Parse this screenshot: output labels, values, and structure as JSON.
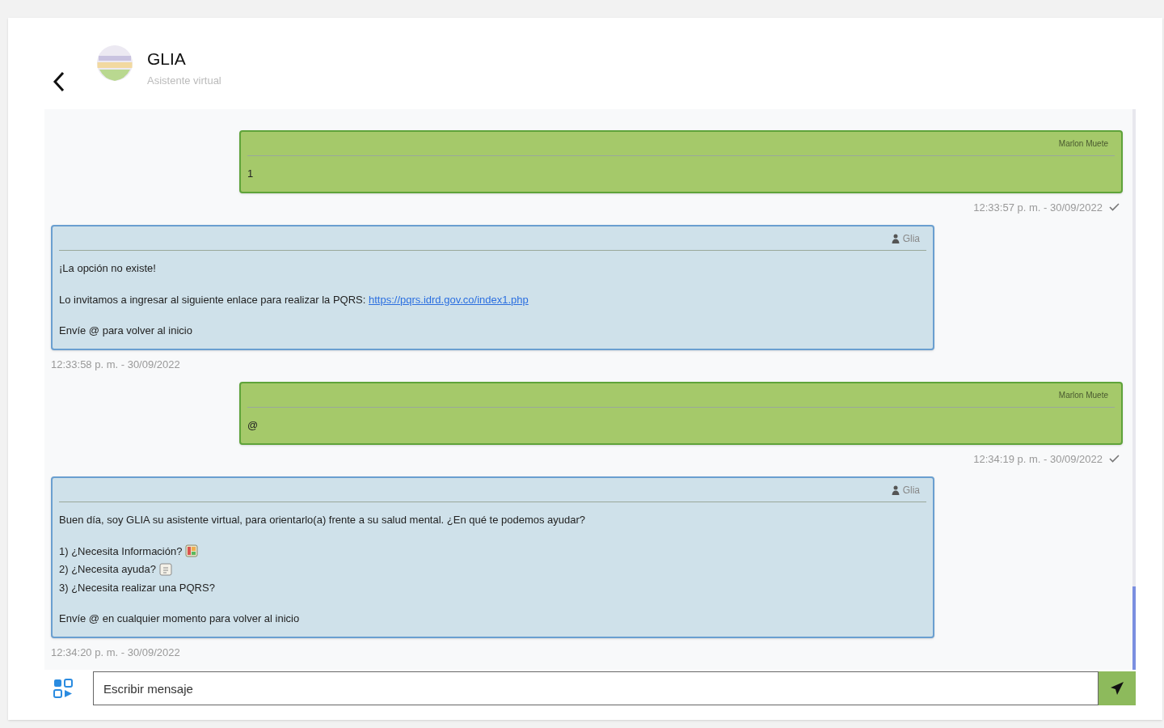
{
  "header": {
    "title": "GLIA",
    "subtitle": "Asistente virtual"
  },
  "messages": [
    {
      "kind": "user",
      "sender": "Marlon Muete",
      "paragraphs": [
        [
          {
            "kind": "plain",
            "text": "1"
          }
        ]
      ],
      "time": "12:33:57 p. m. - 30/09/2022",
      "read": true
    },
    {
      "kind": "bot",
      "sender": "Glia",
      "paragraphs": [
        [
          {
            "kind": "plain",
            "text": "¡La opción no existe!"
          }
        ],
        [
          {
            "kind": "link",
            "text": "Lo invitamos a ingresar al siguiente enlace para realizar la PQRS: ",
            "link": "https://pqrs.idrd.gov.co/index1.php"
          }
        ],
        [
          {
            "kind": "plain",
            "text": "Envíe @ para volver al inicio"
          }
        ]
      ],
      "time": "12:33:58 p. m. - 30/09/2022"
    },
    {
      "kind": "user",
      "sender": "Marlon Muete",
      "paragraphs": [
        [
          {
            "kind": "plain",
            "text": "@"
          }
        ]
      ],
      "time": "12:34:19 p. m. - 30/09/2022",
      "read": true
    },
    {
      "kind": "bot",
      "sender": "Glia",
      "paragraphs": [
        [
          {
            "kind": "plain",
            "text": "Buen día, soy GLIA su asistente virtual, para orientarlo(a) frente a su salud mental. ¿En qué te podemos ayudar?"
          }
        ],
        [
          {
            "kind": "book",
            "text": "1) ¿Necesita Información?"
          },
          {
            "kind": "note",
            "text": "2) ¿Necesita ayuda?"
          },
          {
            "kind": "plain",
            "text": "3) ¿Necesita realizar una PQRS?"
          }
        ],
        [
          {
            "kind": "plain",
            "text": "Envíe @ en cualquier momento para volver al inicio"
          }
        ]
      ],
      "time": "12:34:20 p. m. - 30/09/2022"
    }
  ],
  "composer": {
    "placeholder": "Escribir mensaje"
  }
}
